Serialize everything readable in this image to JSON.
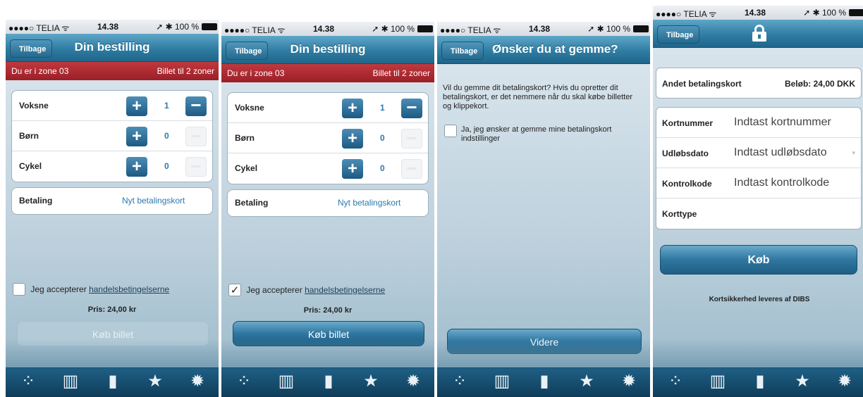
{
  "status_bar": {
    "carrier": "●●●●○ TELIA ᯤ",
    "time": "14.38",
    "battery": "➚ ✱ 100 %"
  },
  "screen1": {
    "back_label": "Tilbage",
    "title": "Din bestilling",
    "zone": "Du er i zone 03",
    "ticket": "Billet til 2 zoner",
    "rows": [
      {
        "label": "Voksne",
        "qty": "1",
        "minus_enabled": true
      },
      {
        "label": "Børn",
        "qty": "0",
        "minus_enabled": false
      },
      {
        "label": "Cykel",
        "qty": "0",
        "minus_enabled": false
      }
    ],
    "payment_label": "Betaling",
    "payment_value": "Nyt betalingskort",
    "accept_prefix": "Jeg accepterer",
    "accept_link": "handelsbetingelserne",
    "accept_checked": false,
    "price": "Pris: 24,00 kr",
    "buy_label": "Køb billet",
    "buy_enabled": false
  },
  "screen2": {
    "back_label": "Tilbage",
    "title": "Din bestilling",
    "zone": "Du er i zone 03",
    "ticket": "Billet til 2 zoner",
    "rows": [
      {
        "label": "Voksne",
        "qty": "1",
        "minus_enabled": true
      },
      {
        "label": "Børn",
        "qty": "0",
        "minus_enabled": false
      },
      {
        "label": "Cykel",
        "qty": "0",
        "minus_enabled": false
      }
    ],
    "payment_label": "Betaling",
    "payment_value": "Nyt betalingskort",
    "accept_prefix": "Jeg accepterer",
    "accept_link": "handelsbetingelserne",
    "accept_checked": true,
    "check_mark": "✓",
    "price": "Pris: 24,00 kr",
    "buy_label": "Køb billet",
    "buy_enabled": true
  },
  "screen3": {
    "back_label": "Tilbage",
    "title": "Ønsker du at gemme?",
    "description": "Vil du gemme dit betalingskort? Hvis du opretter dit betalingskort, er det nemmere når du skal købe billetter og klippekort.",
    "save_label": "Ja, jeg ønsker at gemme mine betalingskort indstillinger",
    "next_label": "Videre"
  },
  "screen4": {
    "back_label": "Tilbage",
    "card_title": "Andet betalingskort",
    "amount": "Beløb: 24,00 DKK",
    "fields": [
      {
        "label": "Kortnummer",
        "placeholder": "Indtast kortnummer"
      },
      {
        "label": "Udløbsdato",
        "placeholder": "Indtast udløbsdato"
      },
      {
        "label": "Kontrolkode",
        "placeholder": "Indtast kontrolkode"
      },
      {
        "label": "Korttype",
        "placeholder": ""
      }
    ],
    "buy_label": "Køb",
    "security_note": "Kortsikkerhed leveres af DIBS"
  },
  "tabbar": {
    "tabs": [
      {
        "icon": "zones-icon",
        "glyph": "⁘"
      },
      {
        "icon": "map-icon",
        "glyph": "▥"
      },
      {
        "icon": "ticket-icon",
        "glyph": "▮"
      },
      {
        "icon": "favorites-star-icon",
        "glyph": "★"
      },
      {
        "icon": "settings-gear-icon",
        "glyph": "✹"
      }
    ]
  },
  "colors": {
    "nav_blue": "#2f7da3",
    "zone_red": "#a9262d",
    "link_blue": "#2a7ab0",
    "tab_dark": "#124664"
  }
}
